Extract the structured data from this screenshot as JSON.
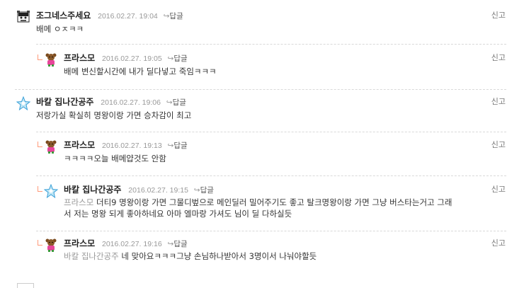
{
  "comments": [
    {
      "nick": "조그네스주세요",
      "date": "2016.02.27. 19:04",
      "reply_label": "답글",
      "report_label": "신고",
      "text": "배메 ㅇㅈㅋㅋ"
    },
    {
      "nick": "프라스모",
      "date": "2016.02.27. 19:05",
      "reply_label": "답글",
      "report_label": "신고",
      "text": "배메 변신할시간에 내가 딜다넣고 죽임ㅋㅋㅋ"
    },
    {
      "nick": "바칼 집나간공주",
      "date": "2016.02.27. 19:06",
      "reply_label": "답글",
      "report_label": "신고",
      "text": "저랑가실 확실히 명왕이랑 가면 승차감이 최고"
    },
    {
      "nick": "프라스모",
      "date": "2016.02.27. 19:13",
      "reply_label": "답글",
      "report_label": "신고",
      "text": "ㅋㅋㅋㅋ오늘 배메얍것도 안함"
    },
    {
      "nick": "바칼 집나간공주",
      "date": "2016.02.27. 19:15",
      "reply_label": "답글",
      "report_label": "신고",
      "mention": "프라스모",
      "text_line1": "더티9 명왕이랑 가면 그물디벞으로 메인딜러 밀어주기도 좋고 탈크명왕이랑 가면 그냥 버스타는거고 그래",
      "text_line2": "서 저는 명왕 되게 좋아하네요 아마 엘마랑 가셔도 님이 딜 다하실듯"
    },
    {
      "nick": "프라스모",
      "date": "2016.02.27. 19:16",
      "reply_label": "답글",
      "report_label": "신고",
      "mention": "바칼 집나간공주",
      "text": "네 맞아요ㅋㅋㅋ그냥 손님하나받아서 3명이서 나눠야할듯"
    }
  ],
  "colors": {
    "nick": "#222222",
    "date": "#999999",
    "mention": "#999999",
    "corner": "#ff9a7a",
    "divider": "#d9d9d9"
  },
  "icons": {
    "avatar_1": "black-white-character-avatar",
    "avatar_2": "pink-teddy-bear-avatar",
    "avatar_3": "blue-star-fairy-avatar"
  }
}
